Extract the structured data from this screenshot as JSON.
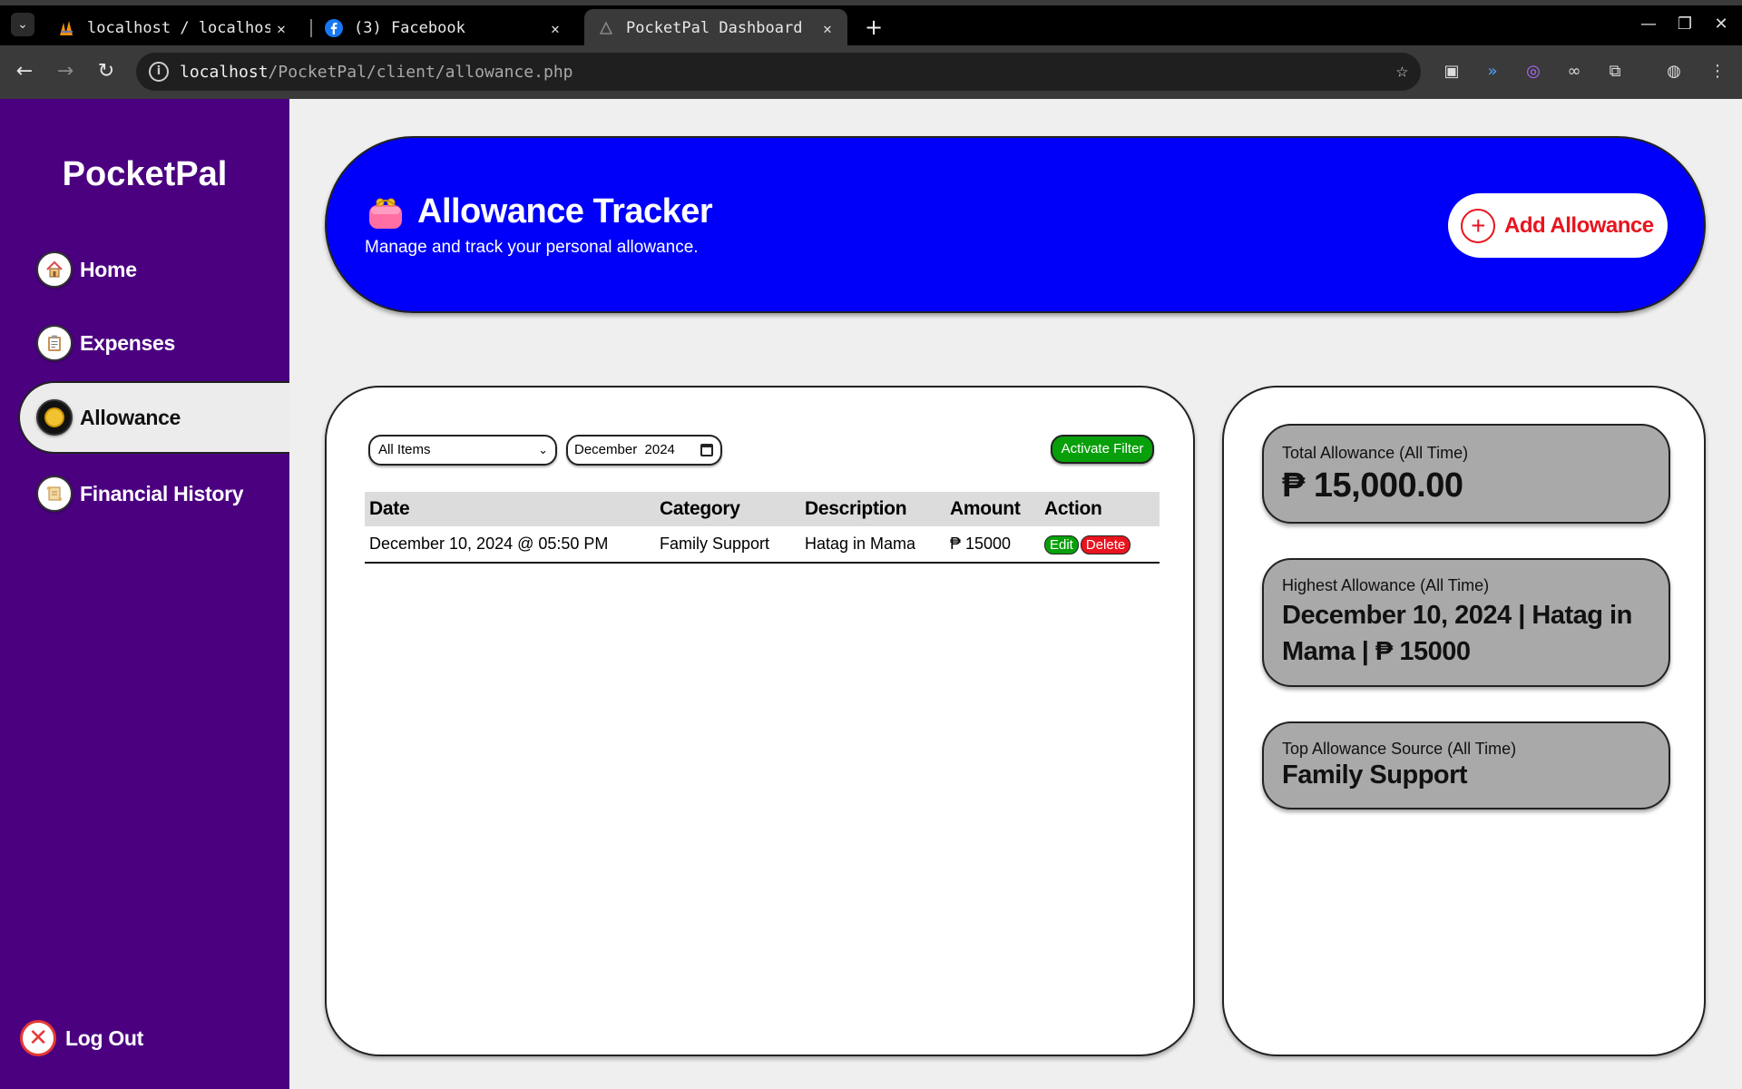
{
  "browser": {
    "tabs": [
      {
        "title": "localhost / localhost"
      },
      {
        "title": "(3) Facebook"
      },
      {
        "title": "PocketPal Dashboard"
      }
    ],
    "url": {
      "host": "localhost",
      "path": "/PocketPal/client/allowance.php"
    }
  },
  "sidebar": {
    "brand": "PocketPal",
    "items": [
      {
        "label": "Home",
        "icon": "house-icon"
      },
      {
        "label": "Expenses",
        "icon": "clipboard-icon"
      },
      {
        "label": "Allowance",
        "icon": "coin-icon",
        "active": true
      },
      {
        "label": "Financial History",
        "icon": "scroll-icon"
      }
    ],
    "logout": "Log Out"
  },
  "header": {
    "title": "Allowance Tracker",
    "subtitle": "Manage and track your personal allowance.",
    "add_button": "Add Allowance"
  },
  "filters": {
    "category_selected": "All Items",
    "month_value": "December  2024",
    "activate_label": "Activate Filter"
  },
  "table": {
    "columns": [
      "Date",
      "Category",
      "Description",
      "Amount",
      "Action"
    ],
    "rows": [
      {
        "date": "December 10, 2024 @ 05:50 PM",
        "category": "Family Support",
        "description": "Hatag in Mama",
        "amount": "₱ 15000",
        "edit": "Edit",
        "delete": "Delete"
      }
    ]
  },
  "stats": {
    "total": {
      "label": "Total Allowance (All Time)",
      "value": "₱ 15,000.00"
    },
    "highest": {
      "label": "Highest Allowance (All Time)",
      "value": "December 10, 2024 | Hatag in Mama | ₱ 15000"
    },
    "top_source": {
      "label": "Top Allowance Source (All Time)",
      "value": "Family Support"
    }
  },
  "colors": {
    "sidebar": "#4b0080",
    "banner": "#0000fa",
    "accent_red": "#e8141e",
    "accent_green": "#08a00a",
    "stat_card": "#a9a9a9"
  }
}
